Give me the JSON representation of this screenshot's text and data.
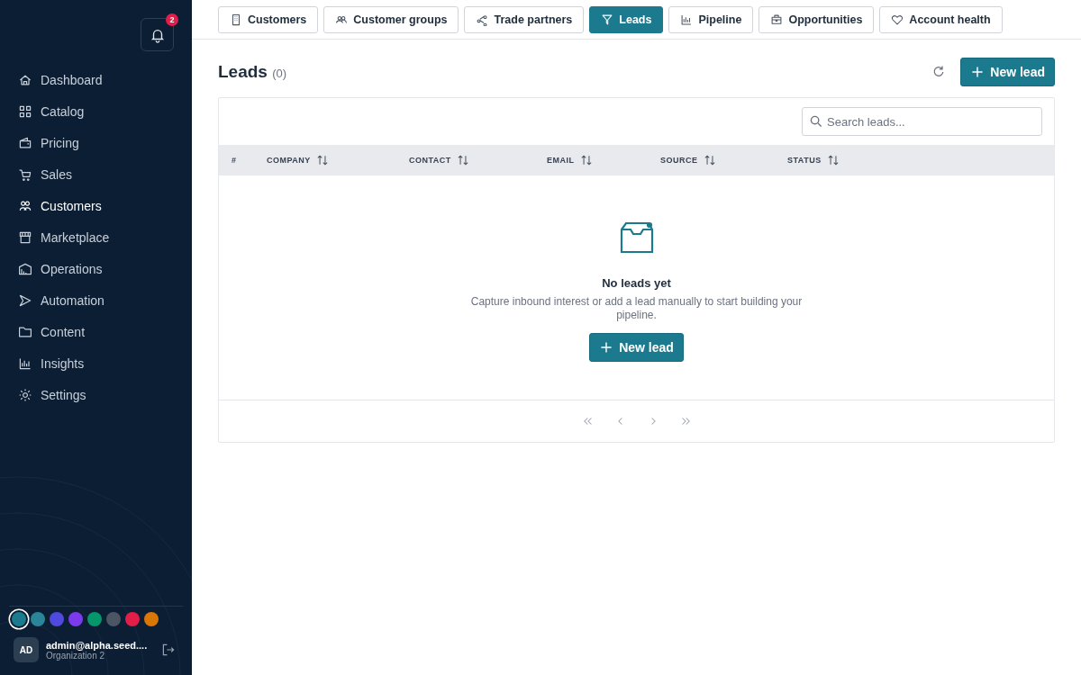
{
  "notifications": {
    "badge": "2"
  },
  "sidebar": {
    "items": [
      {
        "label": "Dashboard",
        "selected": false
      },
      {
        "label": "Catalog",
        "selected": false
      },
      {
        "label": "Pricing",
        "selected": false
      },
      {
        "label": "Sales",
        "selected": false
      },
      {
        "label": "Customers",
        "selected": true
      },
      {
        "label": "Marketplace",
        "selected": false
      },
      {
        "label": "Operations",
        "selected": false
      },
      {
        "label": "Automation",
        "selected": false
      },
      {
        "label": "Content",
        "selected": false
      },
      {
        "label": "Insights",
        "selected": false
      },
      {
        "label": "Settings",
        "selected": false
      }
    ]
  },
  "theme_colors": [
    {
      "color": "#1b7a8e",
      "selected": true
    },
    {
      "color": "#2a8599",
      "selected": false
    },
    {
      "color": "#5049dd",
      "selected": false
    },
    {
      "color": "#7c3aed",
      "selected": false
    },
    {
      "color": "#059669",
      "selected": false
    },
    {
      "color": "#4b5563",
      "selected": false
    },
    {
      "color": "#e11d48",
      "selected": false
    },
    {
      "color": "#d97706",
      "selected": false
    }
  ],
  "user": {
    "initials": "AD",
    "email": "admin@alpha.seed....",
    "organization": "Organization 2"
  },
  "tabs": [
    {
      "label": "Customers",
      "selected": false
    },
    {
      "label": "Customer groups",
      "selected": false
    },
    {
      "label": "Trade partners",
      "selected": false
    },
    {
      "label": "Leads",
      "selected": true
    },
    {
      "label": "Pipeline",
      "selected": false
    },
    {
      "label": "Opportunities",
      "selected": false
    },
    {
      "label": "Account health",
      "selected": false
    }
  ],
  "page": {
    "title": "Leads",
    "count": "(0)",
    "new_button": "New lead"
  },
  "search": {
    "placeholder": "Search leads..."
  },
  "table": {
    "columns": [
      "#",
      "COMPANY",
      "CONTACT",
      "EMAIL",
      "SOURCE",
      "STATUS"
    ]
  },
  "empty_state": {
    "title": "No leads yet",
    "message": "Capture inbound interest or add a lead manually to start building your pipeline.",
    "button": "New lead"
  }
}
